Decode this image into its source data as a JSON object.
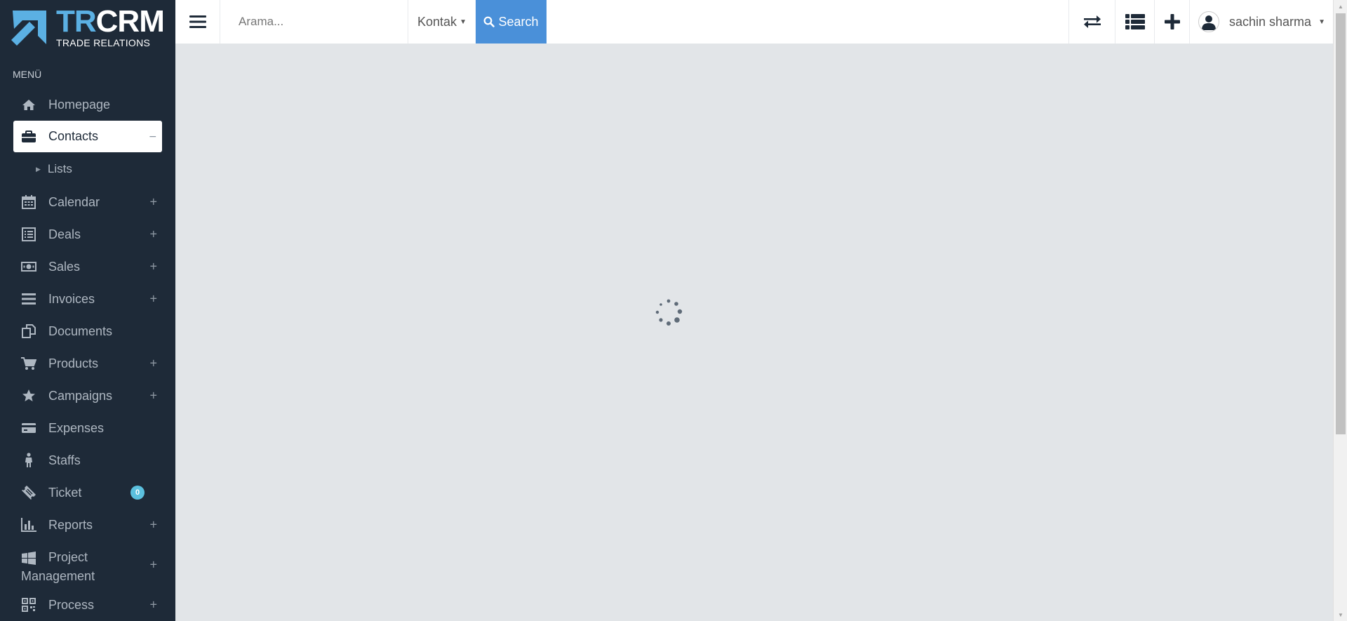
{
  "logo": {
    "primary": "TR",
    "secondary": "CRM",
    "tagline": "TRADE RELATIONS"
  },
  "sidebar": {
    "menu_header": "MENÜ",
    "items": [
      {
        "label": "Homepage",
        "icon": "home-icon",
        "expandable": false
      },
      {
        "label": "Contacts",
        "icon": "briefcase-icon",
        "expandable": true,
        "expanded": true,
        "toggle": "−"
      },
      {
        "label": "Calendar",
        "icon": "calendar-icon",
        "expandable": true,
        "toggle": "+"
      },
      {
        "label": "Deals",
        "icon": "list-alt-icon",
        "expandable": true,
        "toggle": "+"
      },
      {
        "label": "Sales",
        "icon": "money-icon",
        "expandable": true,
        "toggle": "+"
      },
      {
        "label": "Invoices",
        "icon": "bars-icon",
        "expandable": true,
        "toggle": "+"
      },
      {
        "label": "Documents",
        "icon": "copy-icon",
        "expandable": false
      },
      {
        "label": "Products",
        "icon": "cart-icon",
        "expandable": true,
        "toggle": "+"
      },
      {
        "label": "Campaigns",
        "icon": "star-icon",
        "expandable": true,
        "toggle": "+"
      },
      {
        "label": "Expenses",
        "icon": "credit-card-icon",
        "expandable": false
      },
      {
        "label": "Staffs",
        "icon": "male-icon",
        "expandable": false
      },
      {
        "label": "Ticket",
        "icon": "ticket-icon",
        "expandable": false,
        "badge": "0"
      },
      {
        "label": "Reports",
        "icon": "bar-chart-icon",
        "expandable": true,
        "toggle": "+"
      },
      {
        "label_line1": "Project",
        "label_line2": "Management",
        "icon": "windows-icon",
        "expandable": true,
        "toggle": "+"
      },
      {
        "label": "Process",
        "icon": "qrcode-icon",
        "expandable": true,
        "toggle": "+"
      }
    ],
    "contacts_submenu": [
      {
        "label": "Lists"
      }
    ]
  },
  "topbar": {
    "search_placeholder": "Arama...",
    "search_type": "Kontak",
    "search_button": "Search",
    "user_name": "sachin sharma"
  },
  "colors": {
    "sidebar_bg": "#1e2a38",
    "accent": "#4a90d9",
    "logo_blue": "#5bb0e3",
    "content_bg": "#e2e5e8",
    "badge": "#5bc0de"
  },
  "content": {
    "state": "loading",
    "spinner_icon": "loading-spinner-icon"
  }
}
